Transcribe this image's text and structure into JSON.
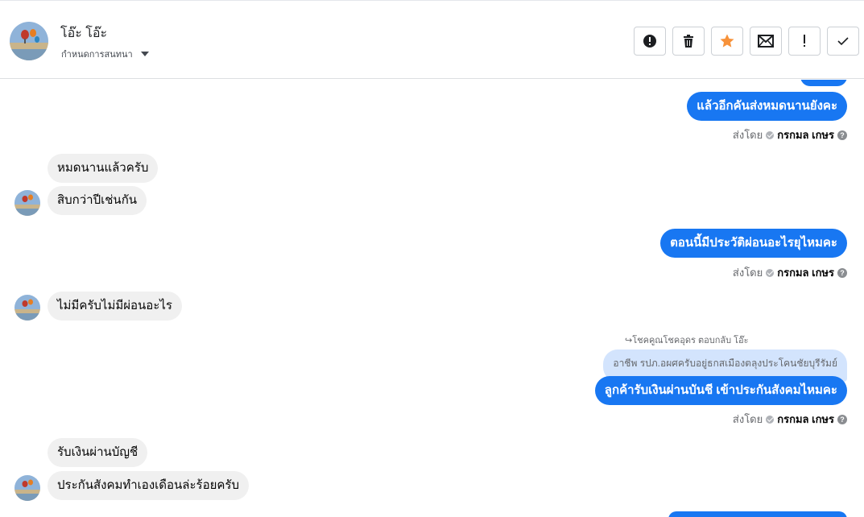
{
  "header": {
    "contact_name": "โอ๊ะ โอ๊ะ",
    "assign_label": "กำหนดการสนทนา",
    "toolbar": [
      {
        "name": "spam-button",
        "icon": "alert-circle-icon"
      },
      {
        "name": "delete-button",
        "icon": "trash-icon"
      },
      {
        "name": "star-button",
        "icon": "star-icon"
      },
      {
        "name": "mark-unread-button",
        "icon": "envelope-icon"
      },
      {
        "name": "follow-up-button",
        "icon": "exclamation-icon"
      },
      {
        "name": "done-button",
        "icon": "check-icon"
      }
    ]
  },
  "colors": {
    "accent": "#1877f2",
    "star": "#f7923a",
    "incoming_bubble": "#f0f0f0",
    "quoted_bubble": "#d3e4fd"
  },
  "messages": {
    "out1": "แล้วอีกคันส่งหมดนานยังคะ",
    "sent_by_label": "ส่งโดย",
    "agent_name": "กรกมล เกษร",
    "help_glyph": "?",
    "in1a": "หมดนานแล้วครับ",
    "in1b": "สิบกว่าปีเช่นกัน",
    "out2": "ตอนนี้มีประวัติผ่อนอะไรยุไหมคะ",
    "in2": "ไม่มีครับไม่มีผ่อนอะไร",
    "reply_info": "โชคคูณโชคอุดร ตอบกลับ โอ๊ะ",
    "quoted": "อาชีพ รปภ.อผศครับอยู่ธกสเมืองตลุงประโคนชัยบุรีรัมย์",
    "out3": "ลูกค้ารับเงินผ่านบันชี เข้าประกันสังคมไหมคะ",
    "in3a": "รับเงินผ่านบัญชี",
    "in3b": "ประกันสังคมทำเองเดือนล่ะร้อยครับ"
  }
}
